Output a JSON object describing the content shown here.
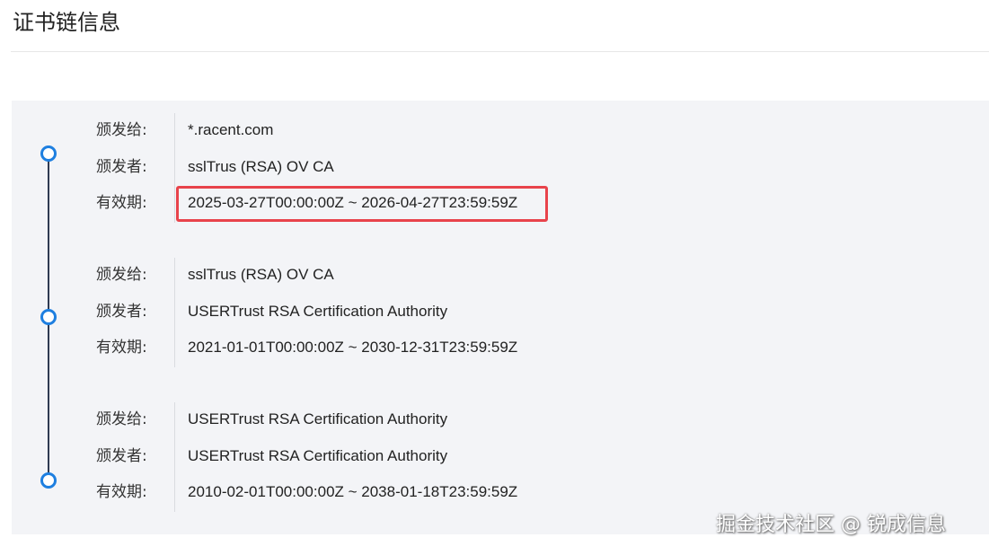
{
  "page": {
    "title": "证书链信息"
  },
  "certificates": [
    {
      "issued_to_label": "颁发给:",
      "issued_to": "*.racent.com",
      "issued_by_label": "颁发者:",
      "issued_by": "sslTrus (RSA) OV CA",
      "validity_label": "有效期:",
      "validity": "2025-03-27T00:00:00Z ~ 2026-04-27T23:59:59Z",
      "validity_highlighted": true
    },
    {
      "issued_to_label": "颁发给:",
      "issued_to": "sslTrus (RSA) OV CA",
      "issued_by_label": "颁发者:",
      "issued_by": "USERTrust RSA Certification Authority",
      "validity_label": "有效期:",
      "validity": "2021-01-01T00:00:00Z ~ 2030-12-31T23:59:59Z",
      "validity_highlighted": false
    },
    {
      "issued_to_label": "颁发给:",
      "issued_to": "USERTrust RSA Certification Authority",
      "issued_by_label": "颁发者:",
      "issued_by": "USERTrust RSA Certification Authority",
      "validity_label": "有效期:",
      "validity": "2010-02-01T00:00:00Z ~ 2038-01-18T23:59:59Z",
      "validity_highlighted": false
    }
  ],
  "watermark": {
    "text": "掘金技术社区 @ 锐成信息"
  },
  "colors": {
    "timeline_dot": "#1e7fe0",
    "timeline_line": "#2f3a52",
    "panel_background": "#f3f4f7",
    "highlight_border": "#e8434b"
  }
}
